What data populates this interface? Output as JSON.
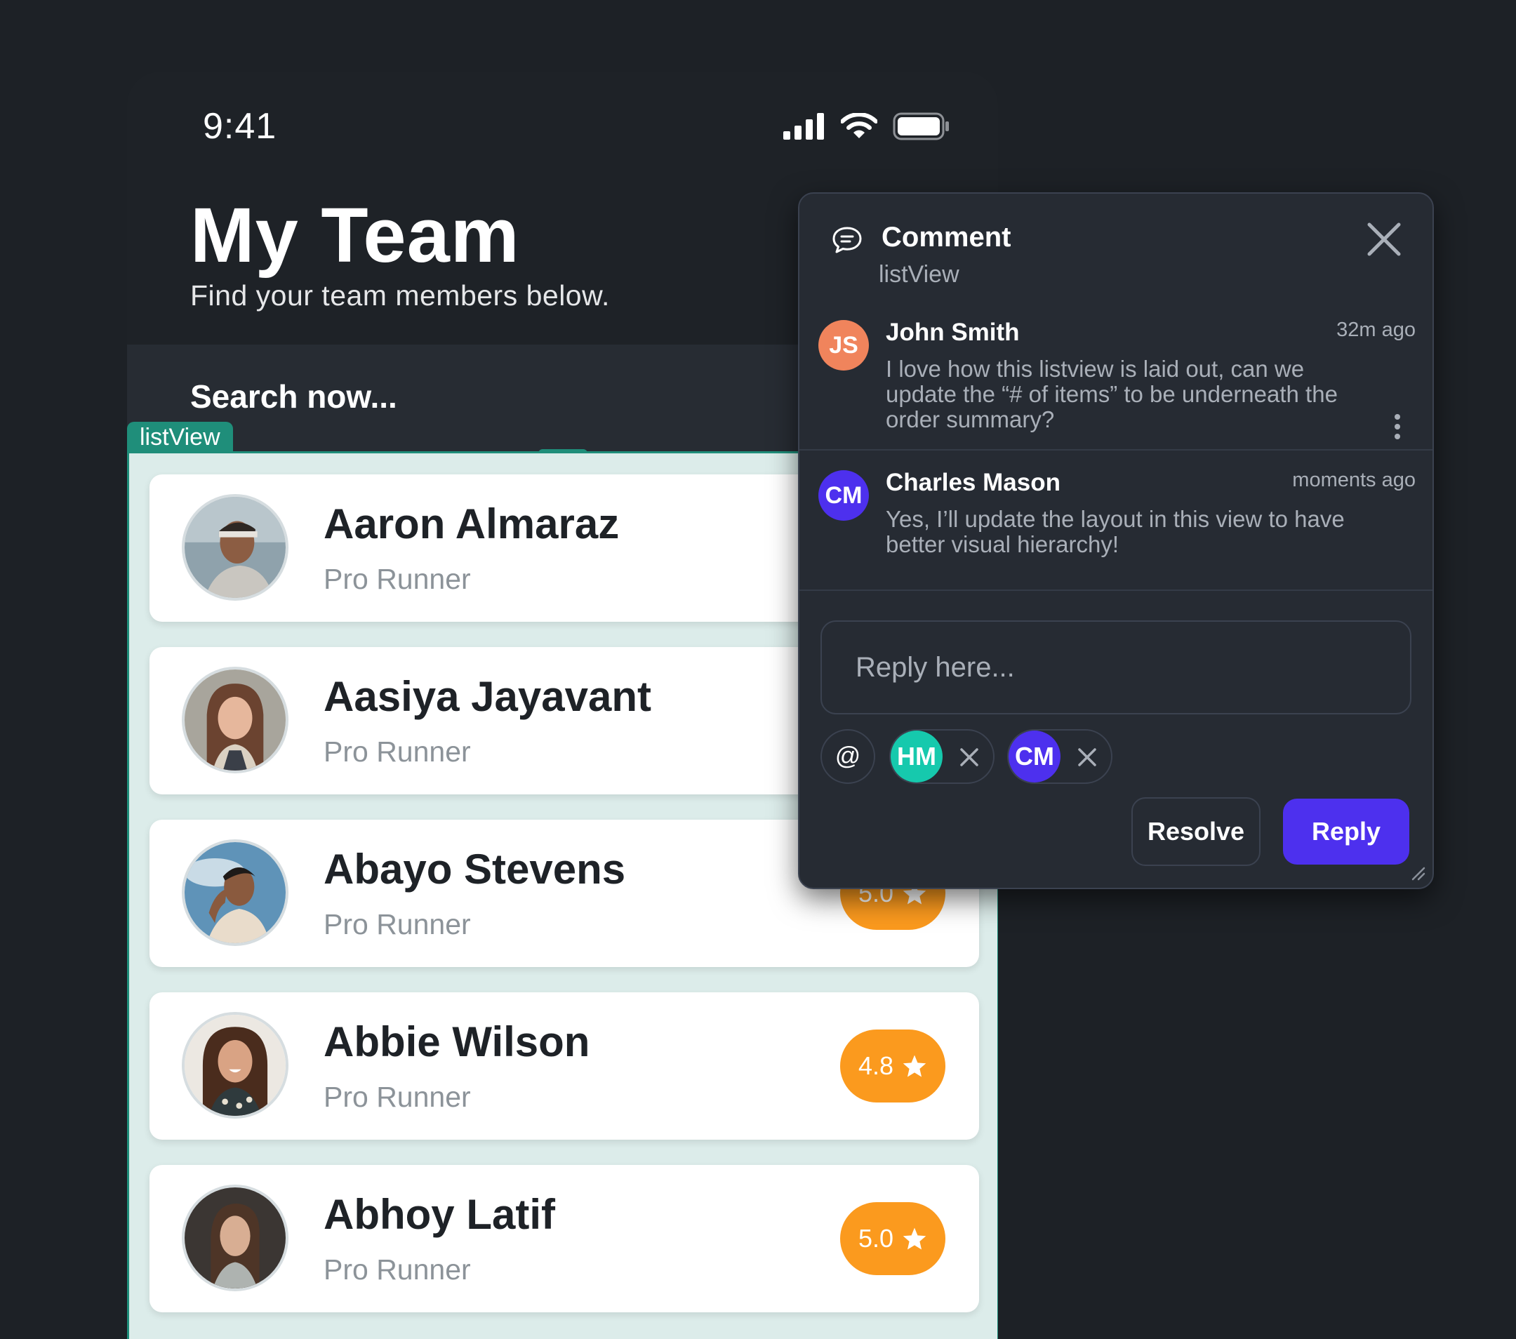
{
  "status_bar": {
    "time": "9:41",
    "icons": [
      "signal-icon",
      "wifi-icon",
      "battery-icon"
    ]
  },
  "header": {
    "title": "My Team",
    "subtitle": "Find your team members below."
  },
  "search": {
    "placeholder": "Search now..."
  },
  "listview_tag": "listView",
  "members": [
    {
      "name": "Aaron Almaraz",
      "role": "Pro Runner",
      "rating": ""
    },
    {
      "name": "Aasiya Jayavant",
      "role": "Pro Runner",
      "rating": ""
    },
    {
      "name": "Abayo Stevens",
      "role": "Pro Runner",
      "rating": "5.0"
    },
    {
      "name": "Abbie Wilson",
      "role": "Pro Runner",
      "rating": "4.8"
    },
    {
      "name": "Abhoy Latif",
      "role": "Pro Runner",
      "rating": "5.0"
    }
  ],
  "comment_panel": {
    "title": "Comment",
    "context": "listView",
    "comments": [
      {
        "initials": "JS",
        "avatar_color": "#f0845c",
        "author": "John Smith",
        "time": "32m ago",
        "text_lines": [
          "I love how this listview is laid out, can we",
          "update the “# of items” to be underneath the",
          "order summary?"
        ]
      },
      {
        "initials": "CM",
        "avatar_color": "#4d30ee",
        "author": "Charles Mason",
        "time": "moments ago",
        "text_lines": [
          "Yes, I’ll update the layout in this view to have",
          "better visual hierarchy!"
        ]
      }
    ],
    "reply_placeholder": "Reply here...",
    "mention_symbol": "@",
    "mentions": [
      {
        "initials": "HM",
        "color": "#16c9ad"
      },
      {
        "initials": "CM",
        "color": "#4d30ee"
      }
    ],
    "resolve_label": "Resolve",
    "reply_label": "Reply"
  },
  "colors": {
    "background": "#1d2126",
    "accent_teal": "#1f8e7a",
    "rating_orange": "#fb9a1e",
    "reply_purple": "#4d30ee"
  }
}
